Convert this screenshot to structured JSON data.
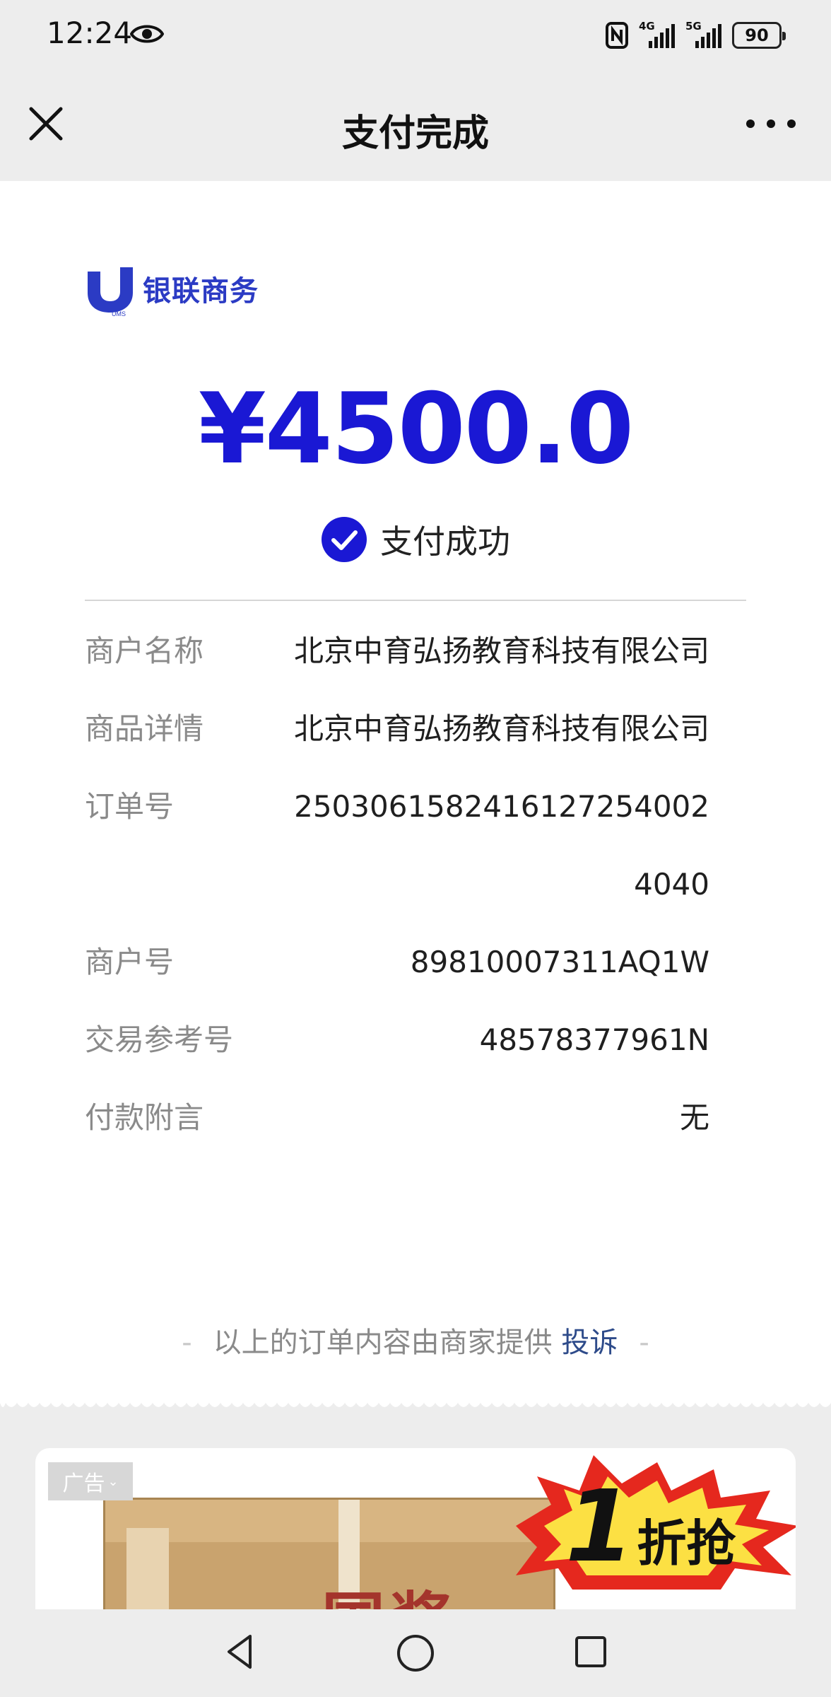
{
  "status_bar": {
    "time": "12:24",
    "net1": "4G",
    "net2": "5G",
    "battery": "90"
  },
  "nav": {
    "title": "支付完成"
  },
  "brand": {
    "logo_sub": "UMS",
    "name": "银联商务",
    "color": "#2b3bc4"
  },
  "payment": {
    "amount": "¥4500.0",
    "status": "支付成功",
    "accent_color": "#1a18d4"
  },
  "details": [
    {
      "label": "商户名称",
      "value": "北京中育弘扬教育科技有限公司"
    },
    {
      "label": "商品详情",
      "value": "北京中育弘扬教育科技有限公司"
    },
    {
      "label": "订单号",
      "value": "25030615824161272540024040"
    },
    {
      "label": "商户号",
      "value": "89810007311AQ1W"
    },
    {
      "label": "交易参考号",
      "value": "48578377961N"
    },
    {
      "label": "付款附言",
      "value": "无"
    }
  ],
  "footnote": {
    "text": "以上的订单内容由商家提供",
    "link": "投诉"
  },
  "ad": {
    "tag": "广告",
    "box_text": "国酱",
    "burst_number": "1",
    "burst_text": "折抢"
  },
  "icons": [
    "eye-icon",
    "nfc-icon",
    "close-icon",
    "more-icon",
    "check-circle-icon",
    "back-icon",
    "home-icon",
    "recent-apps-icon"
  ]
}
